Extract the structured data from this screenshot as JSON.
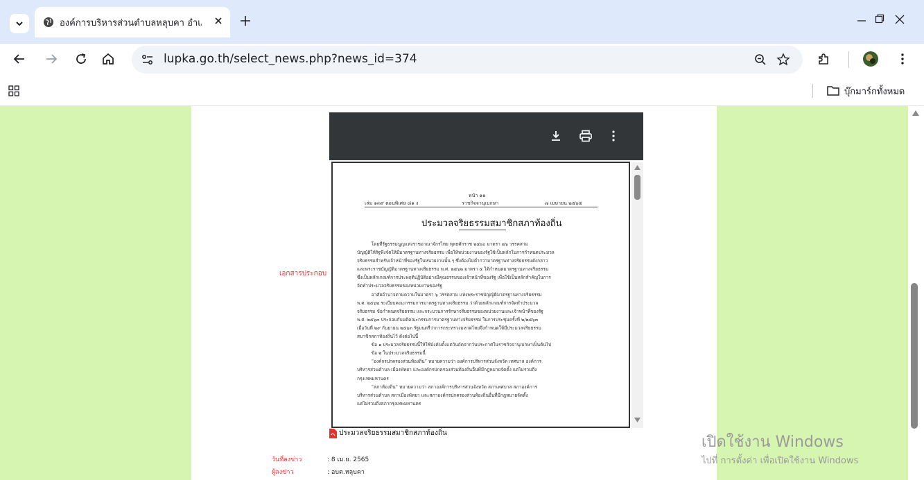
{
  "browser": {
    "tab_title": "องค์การบริหารส่วนตำบลหลุบคา อำเภ",
    "url": "lupka.go.th/select_news.php?news_id=374",
    "bookmarks_label": "บุ๊กมาร์กทั้งหมด"
  },
  "pdf": {
    "page_label": "หน้า ๑๑",
    "header_left": "เล่ม ๑๓๙ ตอนพิเศษ ๘๑ ง",
    "header_center": "ราชกิจจานุเบกษา",
    "header_right": "๗ เมษายน ๒๕๖๕",
    "doc_title": "ประมวลจริยธรรมสมาชิกสภาท้องถิ่น",
    "body_lines": [
      "          โดยที่รัฐธรรมนูญแห่งราชอาณาจักรไทย พุทธศักราช ๒๕๖๐ มาตรา ๗๖ วรรคสาม",
      "บัญญัติให้รัฐพึงจัดให้มีมาตรฐานทางจริยธรรม เพื่อให้หน่วยงานของรัฐใช้เป็นหลักในการกำหนดประมวล",
      "จริยธรรมสำหรับเจ้าหน้าที่ของรัฐในหน่วยงานนั้น ๆ ซึ่งต้องไม่ต่ำกว่ามาตรฐานทางจริยธรรมดังกล่าว",
      "และพระราชบัญญัติมาตรฐานทางจริยธรรม พ.ศ. ๒๕๖๒ มาตรา ๕ ได้กำหนดมาตรฐานทางจริยธรรม",
      "ซึ่งเป็นหลักเกณฑ์การประพฤติปฏิบัติอย่างมีคุณธรรมของเจ้าหน้าที่ของรัฐ เพื่อใช้เป็นหลักสำคัญในการ",
      "จัดทำประมวลจริยธรรมของหน่วยงานของรัฐ",
      "          อาศัยอำนาจตามความในมาตรา ๖ วรรคสาม แห่งพระราชบัญญัติมาตรฐานทางจริยธรรม",
      "พ.ศ. ๒๕๖๒ ระเบียบคณะกรรมการมาตรฐานทางจริยธรรม ว่าด้วยหลักเกณฑ์การจัดทำประมวล",
      "จริยธรรม ข้อกำหนดจริยธรรม และกระบวนการรักษาจริยธรรมของหน่วยงานและเจ้าหน้าที่ของรัฐ",
      "พ.ศ. ๒๕๖๓ ประกอบกับมติคณะกรรมการมาตรฐานทางจริยธรรม ในการประชุมครั้งที่ ๒/๒๕๖๓",
      "เมื่อวันที่ ๒๙ กันยายน ๒๕๖๓ รัฐมนตรีว่าการกระทรวงมหาดไทยจึงกำหนดให้มีประมวลจริยธรรม",
      "สมาชิกสภาท้องถิ่นไว้ ดังต่อไปนี้",
      "          ข้อ ๑ ประมวลจริยธรรมนี้ให้ใช้บังคับตั้งแต่วันถัดจากวันประกาศในราชกิจจานุเบกษาเป็นต้นไป",
      "          ข้อ ๒ ในประมวลจริยธรรมนี้",
      "          “องค์กรปกครองส่วนท้องถิ่น” หมายความว่า องค์การบริหารส่วนจังหวัด เทศบาล องค์การ",
      "บริหารส่วนตำบล เมืองพัทยา และองค์กรปกครองส่วนท้องถิ่นอื่นที่มีกฎหมายจัดตั้ง แต่ไม่รวมถึง",
      "กรุงเทพมหานคร",
      "          “สภาท้องถิ่น” หมายความว่า สภาองค์การบริหารส่วนจังหวัด สภาเทศบาล สภาองค์การ",
      "บริหารส่วนตำบล สภาเมืองพัทยา และสภาองค์กรปกครองส่วนท้องถิ่นอื่นที่มีกฎหมายจัดตั้ง",
      "แต่ไม่รวมถึงสภากรุงเทพมหานคร"
    ]
  },
  "page": {
    "attachment_label": "เอกสารประกอบ",
    "attachment_link": "ประมวลจริยธรรมสมาชิกสภาท้องถิ่น",
    "date_label": "วันที่ลงข่าว",
    "date_value": ": 8 เม.ย. 2565",
    "author_label": "ผู้ลงข่าว",
    "author_value": ": อบต.หลุบคา"
  },
  "watermark": {
    "line1": "เปิดใช้งาน Windows",
    "line2": "ไปที่ การตั้งค่า เพื่อเปิดใช้งาน Windows"
  },
  "colors": {
    "side_green": "#d5f5b1",
    "chrome_frame": "#dee9fb",
    "pdf_toolbar": "#323639",
    "label_red": "#e5322d"
  }
}
